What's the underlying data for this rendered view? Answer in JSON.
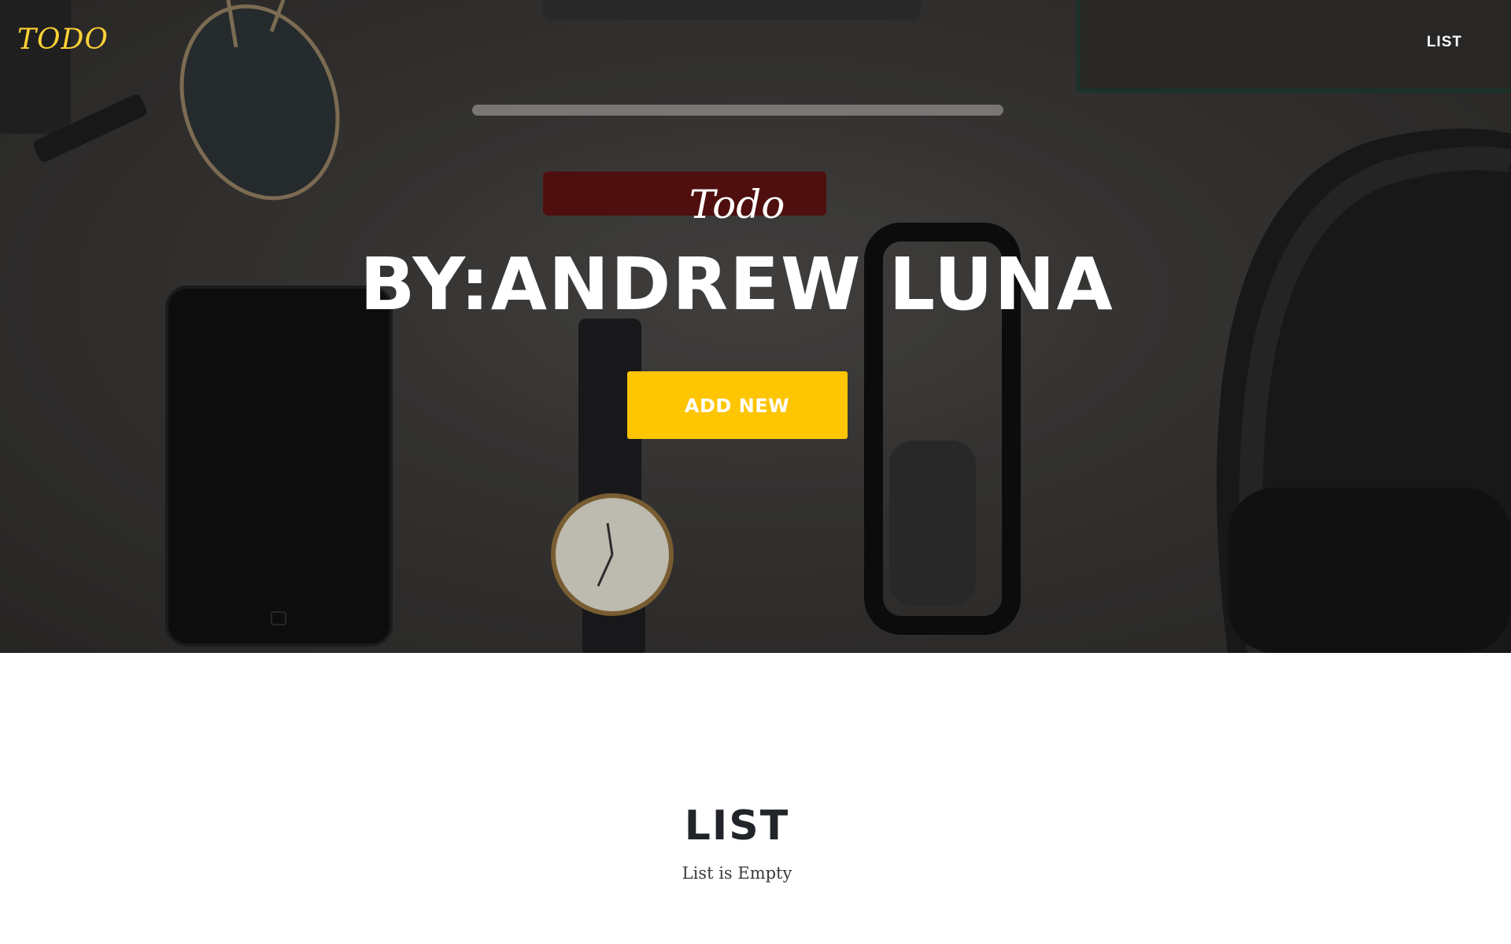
{
  "navbar": {
    "brand": "TODO",
    "links": [
      {
        "label": "LIST"
      }
    ]
  },
  "hero": {
    "subheading": "Todo",
    "heading": "BY:ANDREW LUNA",
    "button_label": "ADD NEW"
  },
  "list_section": {
    "heading": "LIST",
    "empty_message": "List is Empty"
  },
  "colors": {
    "accent": "#fec503",
    "brand": "#fed136",
    "heading_dark": "#212529"
  }
}
